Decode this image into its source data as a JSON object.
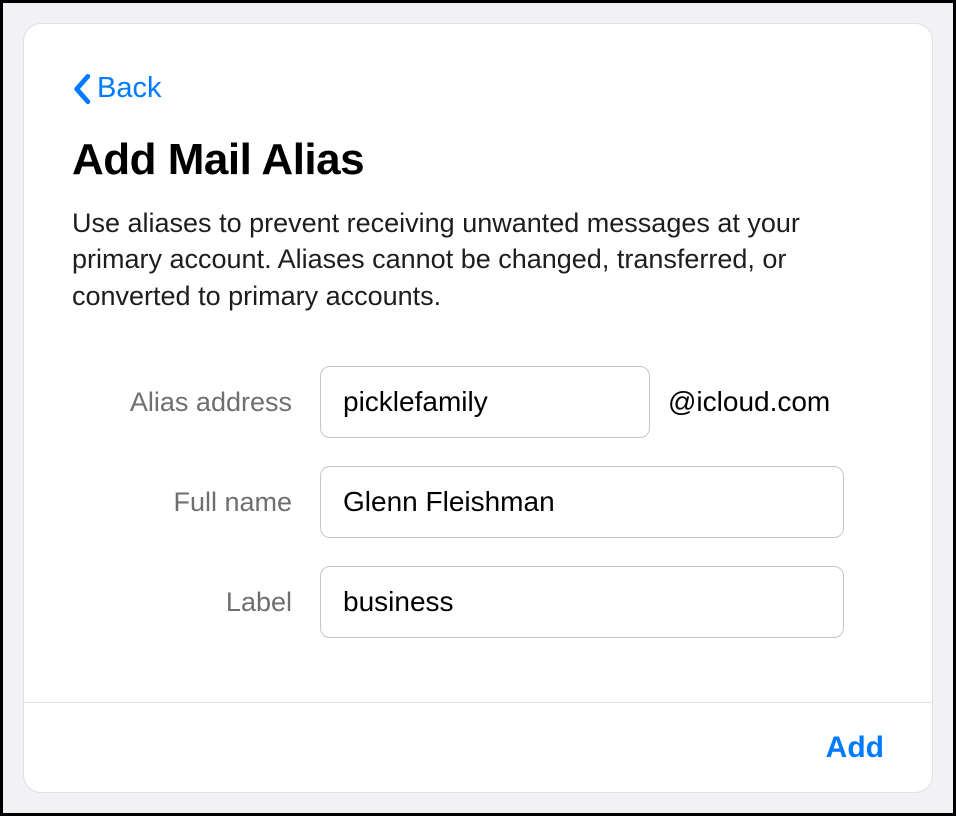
{
  "nav": {
    "back_label": "Back"
  },
  "header": {
    "title": "Add Mail Alias",
    "description": "Use aliases to prevent receiving unwanted messages at your primary account. Aliases cannot be changed, transferred, or converted to primary accounts."
  },
  "form": {
    "alias": {
      "label": "Alias address",
      "value": "picklefamily",
      "domain": "@icloud.com"
    },
    "fullname": {
      "label": "Full name",
      "value": "Glenn Fleishman"
    },
    "label_field": {
      "label": "Label",
      "value": "business"
    }
  },
  "footer": {
    "add_label": "Add"
  },
  "colors": {
    "accent": "#007aff",
    "text_muted": "#6e6e73",
    "border": "#c6c6c8"
  }
}
